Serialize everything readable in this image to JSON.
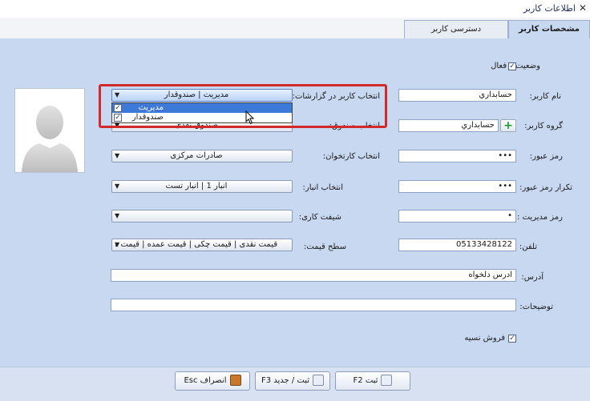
{
  "window": {
    "title": "اطلاعات کاربر",
    "close_glyph": "✕"
  },
  "tabs": [
    {
      "label": "مشخصات کاربر",
      "active": true
    },
    {
      "label": "دسترسی کاربر",
      "active": false
    }
  ],
  "form": {
    "status_label": "وضعیت:",
    "active_label": "فعال",
    "active_checked": true,
    "username_label": "نام کاربر:",
    "username_value": "حسابداري",
    "user_group_label": "گروه کاربر:",
    "user_group_value": "حسابداري",
    "password_label": "رمز عبور:",
    "password_value": "•••",
    "repeat_password_label": "تکرار رمز عبور:",
    "repeat_password_value": "•••",
    "admin_password_label": "رمز مدیریت :",
    "admin_password_value": "•",
    "phone_label": "تلفن:",
    "phone_value": "05133428122",
    "address_label": "آدرس:",
    "address_value": "ادرس دلخواه",
    "notes_label": "توضیحات:",
    "notes_value": "",
    "credit_sale_label": "فروش نسیه",
    "credit_sale_checked": true,
    "report_user_label": "انتخاب کاربر در گزارشات:",
    "report_user_value": "مدیریت | صندوقدار",
    "report_user_options": [
      {
        "label": "مدیریت",
        "checked": true,
        "highlighted": true
      },
      {
        "label": "صندوقدار",
        "checked": true,
        "highlighted": false
      }
    ],
    "cashbox_label": "انتخاب صندوق:",
    "cashbox_value": "صندوق نقدی",
    "workshop_label": "انتخاب کارتخوان:",
    "workshop_value": "صادرات مرکزی",
    "warehouse_label": "انتخاب انبار:",
    "warehouse_value": "انبار 1 | انبار تست",
    "shift_label": "شیفت کاری:",
    "shift_value": "",
    "price_level_label": "سطح قیمت:",
    "price_level_value": "قیمت نقدی | قیمت چکی | قیمت عمده | قیمت همکاری"
  },
  "buttons": {
    "save": "ثبت F2",
    "save_new": "ثبت / جدید F3",
    "cancel": "انصراف Esc"
  },
  "colors": {
    "panel_bg": "#c8d8f0",
    "highlight": "#d22a2a",
    "selection": "#3c79d8"
  }
}
